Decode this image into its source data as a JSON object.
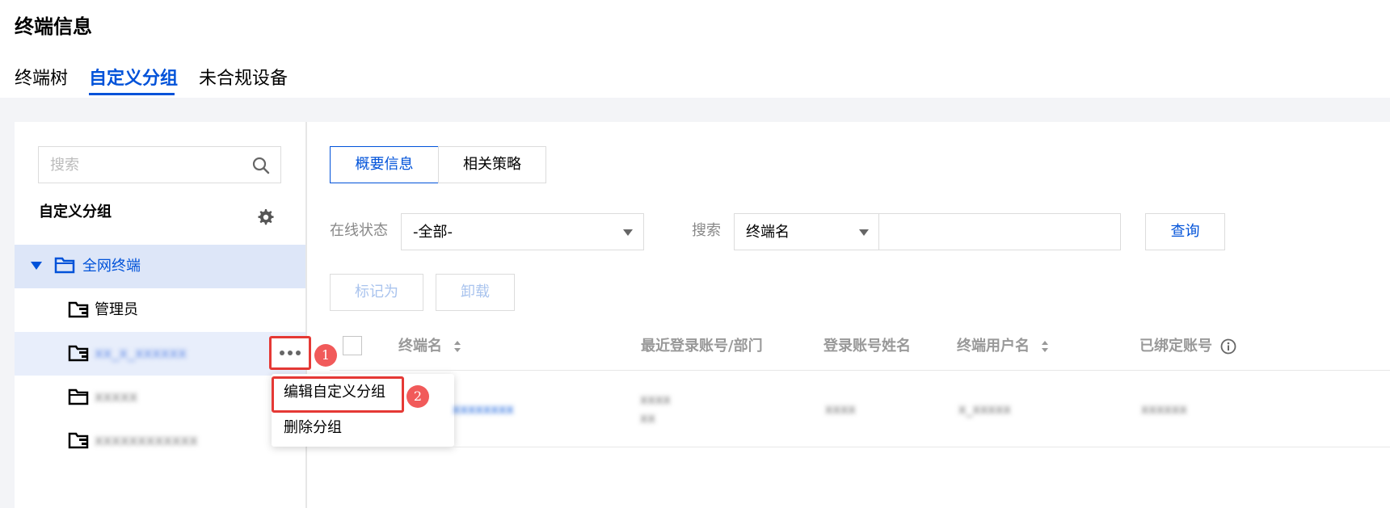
{
  "page": {
    "title": "终端信息"
  },
  "tabs": [
    {
      "label": "终端树"
    },
    {
      "label": "自定义分组"
    },
    {
      "label": "未合规设备"
    }
  ],
  "sidebar": {
    "search_placeholder": "搜索",
    "heading": "自定义分组",
    "tree": [
      {
        "label": "全网终端"
      },
      {
        "label": "管理员"
      },
      {
        "label": "xx_x_xxxxxx"
      },
      {
        "label": "xxxxx"
      },
      {
        "label": "xxxxxxxxxxxx"
      }
    ]
  },
  "context_menu": {
    "items": [
      {
        "label": "编辑自定义分组"
      },
      {
        "label": "删除分组"
      }
    ]
  },
  "annotations": {
    "badge1": "1",
    "badge2": "2"
  },
  "main": {
    "view_tabs": [
      {
        "label": "概要信息"
      },
      {
        "label": "相关策略"
      }
    ],
    "filters": {
      "status_label": "在线状态",
      "status_value": "-全部-",
      "search_label": "搜索",
      "search_field": "终端名",
      "search_value": ""
    },
    "query_button": "查询",
    "actions": [
      {
        "label": "标记为"
      },
      {
        "label": "卸载"
      }
    ],
    "columns": [
      {
        "label": "终端名"
      },
      {
        "label": "最近登录账号/部门"
      },
      {
        "label": "登录账号姓名"
      },
      {
        "label": "终端用户名"
      },
      {
        "label": "已绑定账号"
      }
    ],
    "rows": [
      {
        "name": "xxxxxxxx",
        "account": "xxxx",
        "dept": "xx",
        "real_name": "xxxx",
        "username": "x_xxxxx",
        "bound": "xxxxxx"
      }
    ]
  },
  "colors": {
    "accent": "#0052d9",
    "highlight": "#e53935",
    "selected_row": "#dde6f8"
  }
}
